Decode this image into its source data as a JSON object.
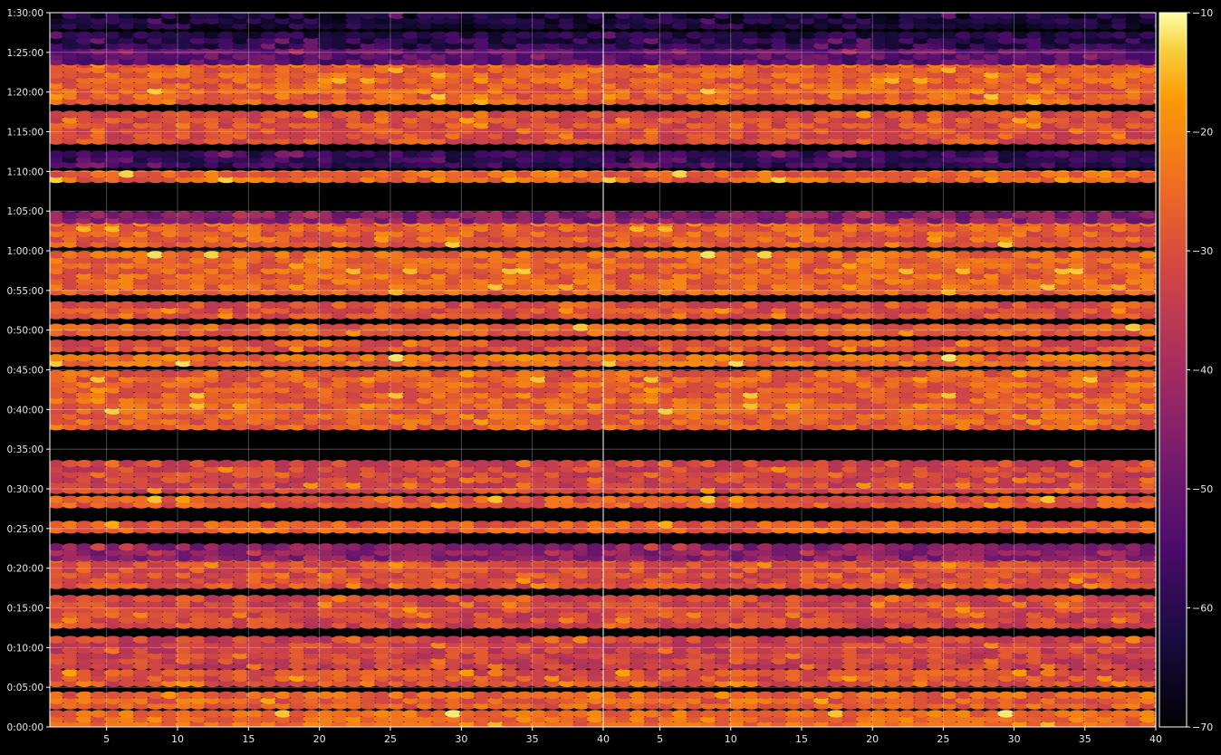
{
  "chart_data": {
    "type": "heatmap",
    "title": "",
    "xlabel": "",
    "ylabel": "",
    "panels": 2,
    "x_range": [
      1,
      40
    ],
    "x_ticks": [
      5,
      10,
      15,
      20,
      25,
      30,
      35,
      40
    ],
    "x_tick_labels": [
      "5",
      "10",
      "15",
      "20",
      "25",
      "30",
      "35",
      "40"
    ],
    "y_range_seconds": [
      0,
      5400
    ],
    "y_tick_labels": [
      "0:00:00",
      "0:05:00",
      "0:10:00",
      "0:15:00",
      "0:20:00",
      "0:25:00",
      "0:30:00",
      "0:35:00",
      "0:40:00",
      "0:45:00",
      "0:50:00",
      "0:55:00",
      "1:00:00",
      "1:05:00",
      "1:10:00",
      "1:15:00",
      "1:20:00",
      "1:25:00",
      "1:30:00"
    ],
    "colorbar": {
      "colormap": "inferno",
      "range": [
        -70,
        -10
      ],
      "ticks": [
        -10,
        -20,
        -30,
        -40,
        -50,
        -60,
        -70
      ],
      "tick_labels": [
        "−10",
        "−20",
        "−30",
        "−40",
        "−50",
        "−60",
        "−70"
      ]
    },
    "grid": true,
    "background": "#000000",
    "activity_bands": [
      {
        "start": "0:00:00",
        "end": "0:01:40",
        "level": -25
      },
      {
        "start": "0:02:20",
        "end": "0:04:00",
        "level": -27
      },
      {
        "start": "0:05:10",
        "end": "0:06:40",
        "level": -30
      },
      {
        "start": "0:07:20",
        "end": "0:11:00",
        "level": -33
      },
      {
        "start": "0:12:30",
        "end": "0:16:00",
        "level": -32
      },
      {
        "start": "0:17:30",
        "end": "0:21:00",
        "level": -30
      },
      {
        "start": "0:21:00",
        "end": "0:22:30",
        "level": -45
      },
      {
        "start": "0:24:30",
        "end": "0:25:30",
        "level": -28
      },
      {
        "start": "0:27:40",
        "end": "0:28:30",
        "level": -28
      },
      {
        "start": "0:29:30",
        "end": "0:33:30",
        "level": -32
      },
      {
        "start": "0:37:30",
        "end": "0:44:30",
        "level": -27
      },
      {
        "start": "0:45:30",
        "end": "0:46:30",
        "level": -25
      },
      {
        "start": "0:47:20",
        "end": "0:48:20",
        "level": -30
      },
      {
        "start": "0:49:20",
        "end": "0:50:20",
        "level": -27
      },
      {
        "start": "0:51:30",
        "end": "0:53:30",
        "level": -30
      },
      {
        "start": "0:54:30",
        "end": "0:59:30",
        "level": -26
      },
      {
        "start": "1:00:30",
        "end": "1:03:30",
        "level": -27
      },
      {
        "start": "1:03:30",
        "end": "1:04:30",
        "level": -45
      },
      {
        "start": "1:08:40",
        "end": "1:09:30",
        "level": -26
      },
      {
        "start": "1:10:30",
        "end": "1:12:00",
        "level": -58
      },
      {
        "start": "1:13:30",
        "end": "1:17:00",
        "level": -30
      },
      {
        "start": "1:18:30",
        "end": "1:23:30",
        "level": -27
      },
      {
        "start": "1:23:30",
        "end": "1:25:00",
        "level": -52
      },
      {
        "start": "1:25:30",
        "end": "1:27:00",
        "level": -60
      },
      {
        "start": "1:28:00",
        "end": "1:30:00",
        "level": -63
      }
    ]
  }
}
